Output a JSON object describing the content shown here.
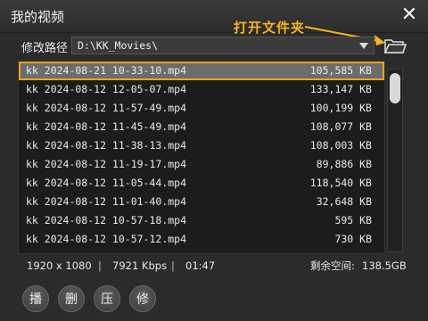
{
  "window": {
    "title": "我的视频",
    "close_icon": "close-icon"
  },
  "annotation": {
    "text": "打开文件夹",
    "color": "#f5b41f"
  },
  "path": {
    "label": "修改路径",
    "value": "D:\\KK_Movies\\"
  },
  "files": [
    {
      "name": "kk 2024-08-21 10-33-10.mp4",
      "size": "105,585 KB",
      "selected": true
    },
    {
      "name": "kk 2024-08-12 12-05-07.mp4",
      "size": "133,147 KB"
    },
    {
      "name": "kk 2024-08-12 11-57-49.mp4",
      "size": "100,199 KB"
    },
    {
      "name": "kk 2024-08-12 11-45-49.mp4",
      "size": "108,077 KB"
    },
    {
      "name": "kk 2024-08-12 11-38-13.mp4",
      "size": "108,003 KB"
    },
    {
      "name": "kk 2024-08-12 11-19-17.mp4",
      "size": "89,886 KB"
    },
    {
      "name": "kk 2024-08-12 11-05-44.mp4",
      "size": "118,540 KB"
    },
    {
      "name": "kk 2024-08-12 11-01-40.mp4",
      "size": "32,648 KB"
    },
    {
      "name": "kk 2024-08-12 10-57-18.mp4",
      "size": "595 KB"
    },
    {
      "name": "kk 2024-08-12 10-57-12.mp4",
      "size": "730 KB"
    }
  ],
  "status": {
    "resolution": "1920 x 1080",
    "bitrate": "7921 Kbps",
    "duration": "01:47",
    "free_space_label": "剩余空间:",
    "free_space_value": "138.5GB",
    "separator": "|"
  },
  "toolbar": {
    "play": "播",
    "delete": "删",
    "compress": "压",
    "edit": "修"
  },
  "colors": {
    "accent": "#f0a51a",
    "selected_row": "#6c6c6c",
    "background": "#2b2b2b"
  }
}
